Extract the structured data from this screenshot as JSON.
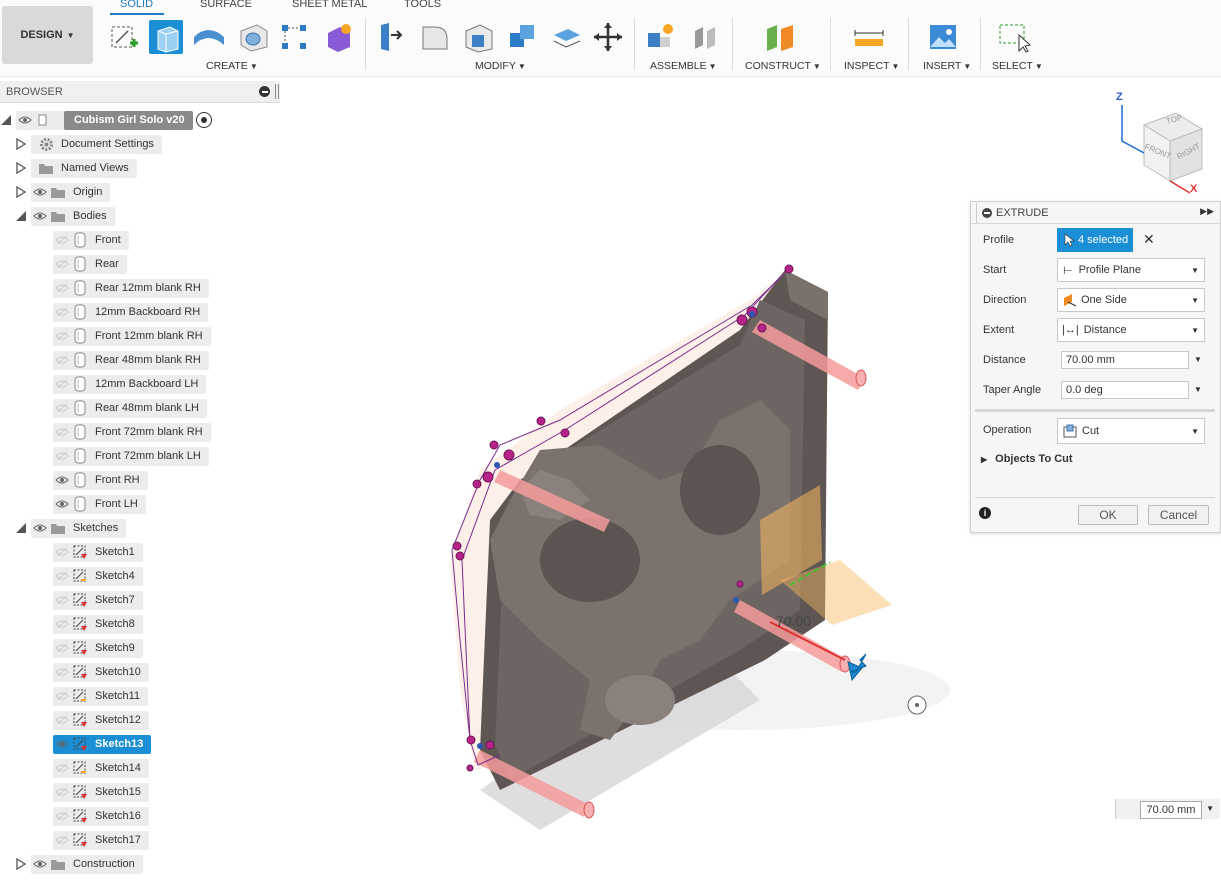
{
  "toolbar": {
    "design_label": "DESIGN",
    "tabs": [
      "SOLID",
      "SURFACE",
      "SHEET METAL",
      "TOOLS"
    ],
    "groups": [
      "CREATE",
      "MODIFY",
      "ASSEMBLE",
      "CONSTRUCT",
      "INSPECT",
      "INSERT",
      "SELECT"
    ],
    "accent_color": "#1a8fd6"
  },
  "browser": {
    "title": "BROWSER",
    "root": "Cubism Girl Solo v20",
    "top_items": [
      "Document Settings",
      "Named Views",
      "Origin",
      "Bodies"
    ],
    "bodies": [
      "Front",
      "Rear",
      "Rear 12mm blank RH",
      "12mm Backboard RH",
      "Front 12mm blank RH",
      "Rear 48mm blank RH",
      "12mm Backboard LH",
      "Rear 48mm blank LH",
      "Front  72mm blank RH",
      "Front  72mm blank LH",
      "Front RH",
      "Front LH"
    ],
    "sketches_label": "Sketches",
    "sketches": [
      "Sketch1",
      "Sketch4",
      "Sketch7",
      "Sketch8",
      "Sketch9",
      "Sketch10",
      "Sketch11",
      "Sketch12",
      "Sketch13",
      "Sketch14",
      "Sketch15",
      "Sketch16",
      "Sketch17"
    ],
    "selected_sketch": "Sketch13",
    "construction_label": "Construction"
  },
  "viewcube": {
    "top": "TOP",
    "front": "FRONT",
    "right": "RIGHT",
    "axis_z": "Z",
    "axis_x": "X"
  },
  "extrude": {
    "title": "EXTRUDE",
    "profile_label": "Profile",
    "profile_value": "4 selected",
    "start_label": "Start",
    "start_value": "Profile Plane",
    "direction_label": "Direction",
    "direction_value": "One Side",
    "extent_label": "Extent",
    "extent_value": "Distance",
    "distance_label": "Distance",
    "distance_value": "70.00 mm",
    "taper_label": "Taper Angle",
    "taper_value": "0.0 deg",
    "operation_label": "Operation",
    "operation_value": "Cut",
    "objects_to_cut": "Objects To Cut",
    "ok": "OK",
    "cancel": "Cancel"
  },
  "viewport": {
    "dimension_text": "70.00",
    "distance_input": "70.00 mm"
  }
}
